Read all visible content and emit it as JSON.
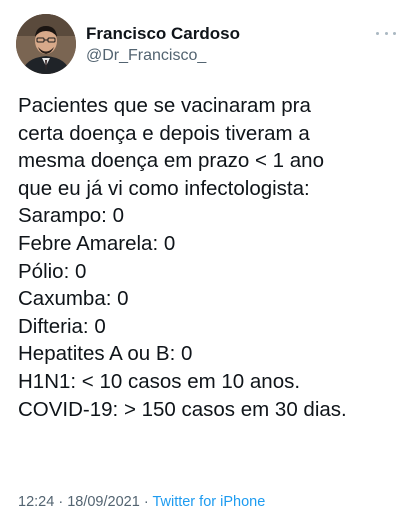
{
  "author": {
    "display_name": "Francisco Cardoso",
    "handle": "@Dr_Francisco_",
    "avatar_icon": "person-avatar"
  },
  "more_icon": "ellipsis-icon",
  "tweet": {
    "lines": [
      "Pacientes que se vacinaram pra",
      "certa doença e depois tiveram a",
      "mesma doença em prazo < 1 ano",
      "que eu já vi como infectologista:",
      "Sarampo: 0",
      "Febre Amarela: 0",
      "Pólio: 0",
      "Caxumba: 0",
      "Difteria: 0",
      "Hepatites A ou B: 0",
      "H1N1: < 10 casos em 10 anos.",
      "COVID-19: > 150 casos em 30 dias."
    ]
  },
  "meta": {
    "time": "12:24",
    "separator": "·",
    "date": "18/09/2021",
    "source": "Twitter for iPhone"
  },
  "colors": {
    "text": "#0f1419",
    "secondary": "#536471",
    "link": "#1d9bf0"
  }
}
